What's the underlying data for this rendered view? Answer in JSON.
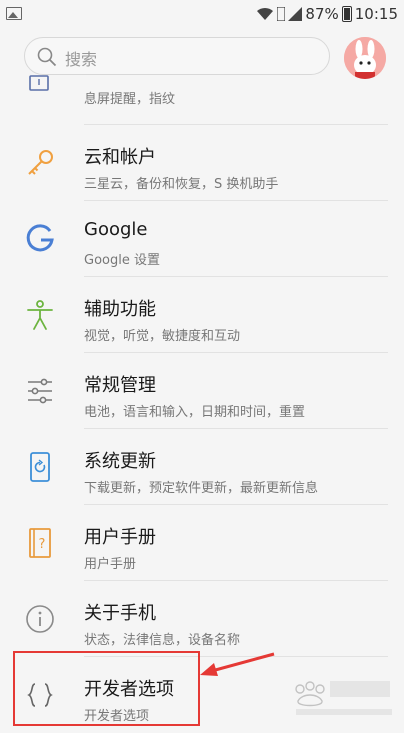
{
  "status_bar": {
    "battery": "87%",
    "time": "10:15"
  },
  "search": {
    "placeholder": "搜索"
  },
  "settings": [
    {
      "key": "partial",
      "title": "",
      "subtitle": "息屏提醒，指纹",
      "icon": "lock-screen-icon"
    },
    {
      "key": "cloud",
      "title": "云和帐户",
      "subtitle": "三星云，备份和恢复，S 换机助手",
      "icon": "key-icon"
    },
    {
      "key": "google",
      "title": "Google",
      "subtitle": "Google 设置",
      "icon": "google-icon"
    },
    {
      "key": "accessibility",
      "title": "辅助功能",
      "subtitle": "视觉，听觉，敏捷度和互动",
      "icon": "accessibility-icon"
    },
    {
      "key": "general",
      "title": "常规管理",
      "subtitle": "电池，语言和输入，日期和时间，重置",
      "icon": "sliders-icon"
    },
    {
      "key": "update",
      "title": "系统更新",
      "subtitle": "下载更新，预定软件更新，最新更新信息",
      "icon": "system-update-icon"
    },
    {
      "key": "manual",
      "title": "用户手册",
      "subtitle": "用户手册",
      "icon": "manual-icon"
    },
    {
      "key": "about",
      "title": "关于手机",
      "subtitle": "状态，法律信息，设备名称",
      "icon": "info-icon"
    },
    {
      "key": "developer",
      "title": "开发者选项",
      "subtitle": "开发者选项",
      "icon": "braces-icon"
    }
  ],
  "colors": {
    "accent_orange": "#f0a040",
    "google_blue": "#4a7fd4",
    "accessibility_green": "#6cb43f",
    "highlight_red": "#e53935"
  }
}
